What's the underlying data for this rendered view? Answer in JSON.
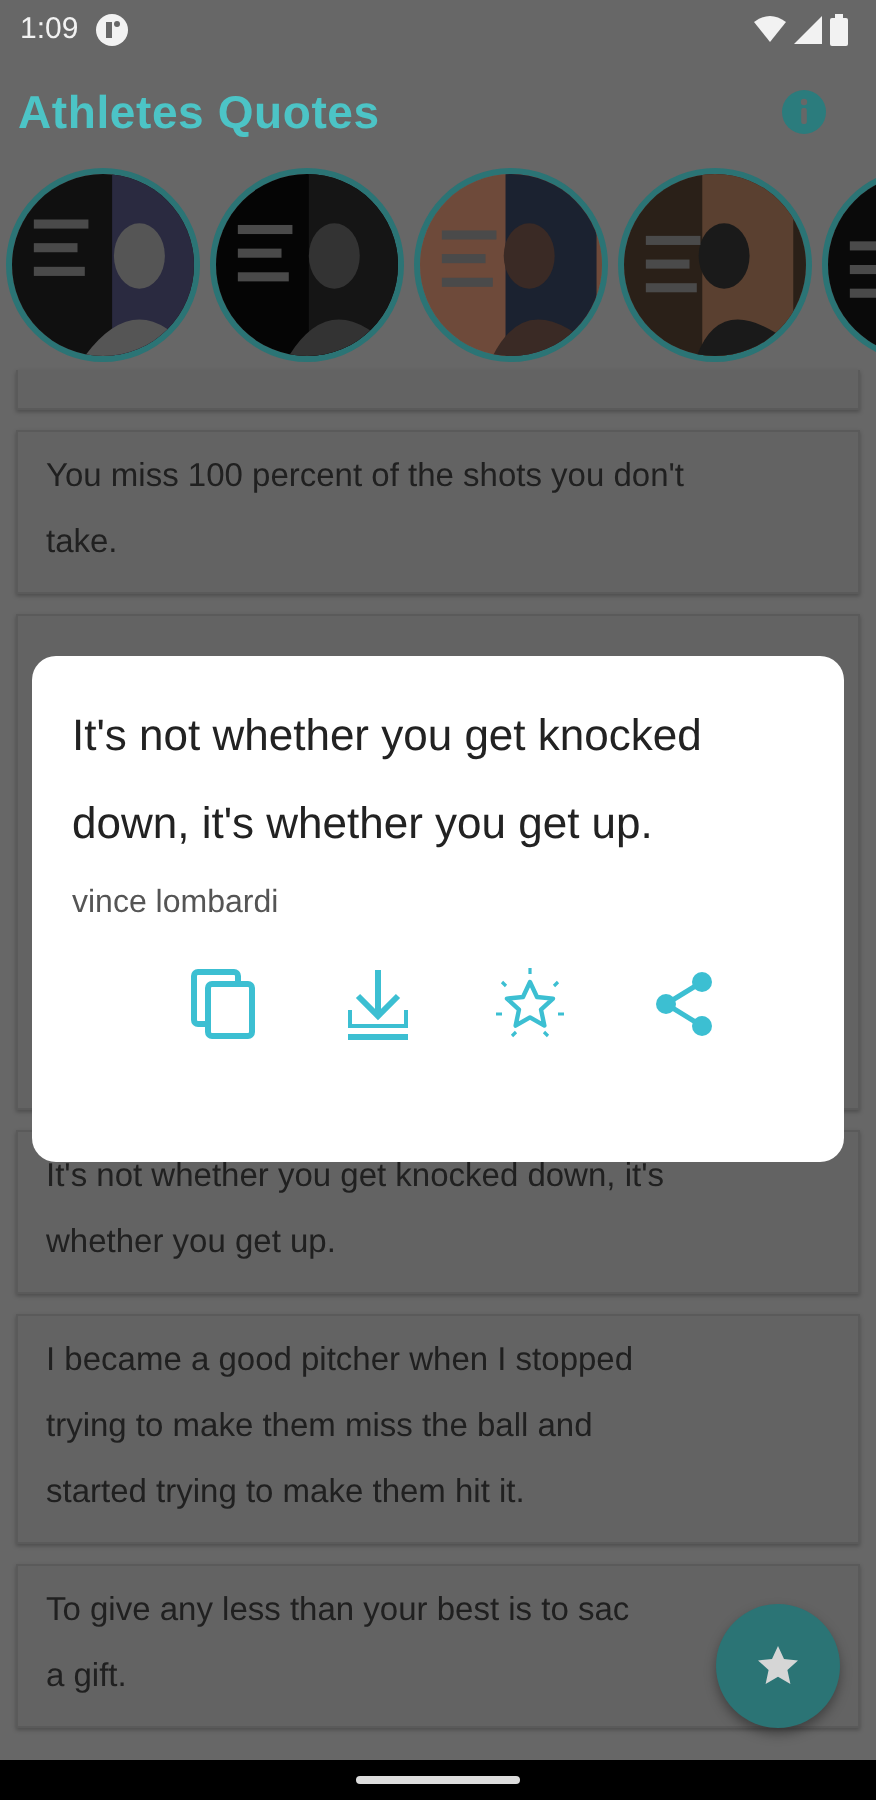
{
  "status_bar": {
    "time": "1:09"
  },
  "app_bar": {
    "title": "Athletes Quotes"
  },
  "cards": [
    {
      "kind": "blank"
    },
    {
      "kind": "quote",
      "lines": [
        "You miss 100 percent of the shots you don't",
        "take."
      ]
    },
    {
      "kind": "blank"
    },
    {
      "kind": "quote",
      "lines": [
        "It's not whether you get knocked down, it's",
        "whether you get up."
      ]
    },
    {
      "kind": "quote",
      "lines": [
        "I became a good pitcher when I stopped",
        "trying to make them miss the ball and",
        "started trying to make them hit it."
      ]
    },
    {
      "kind": "quote",
      "lines": [
        "To give any less than your best is to sac",
        "a gift."
      ]
    }
  ],
  "dialog": {
    "quote": "It's not whether you get knocked down, it's whether you get up.",
    "author": "vince lombardi",
    "actions": [
      {
        "kind": "copy"
      },
      {
        "kind": "download"
      },
      {
        "kind": "favorite"
      },
      {
        "kind": "share"
      }
    ]
  },
  "fab": {
    "kind": "favorite"
  }
}
